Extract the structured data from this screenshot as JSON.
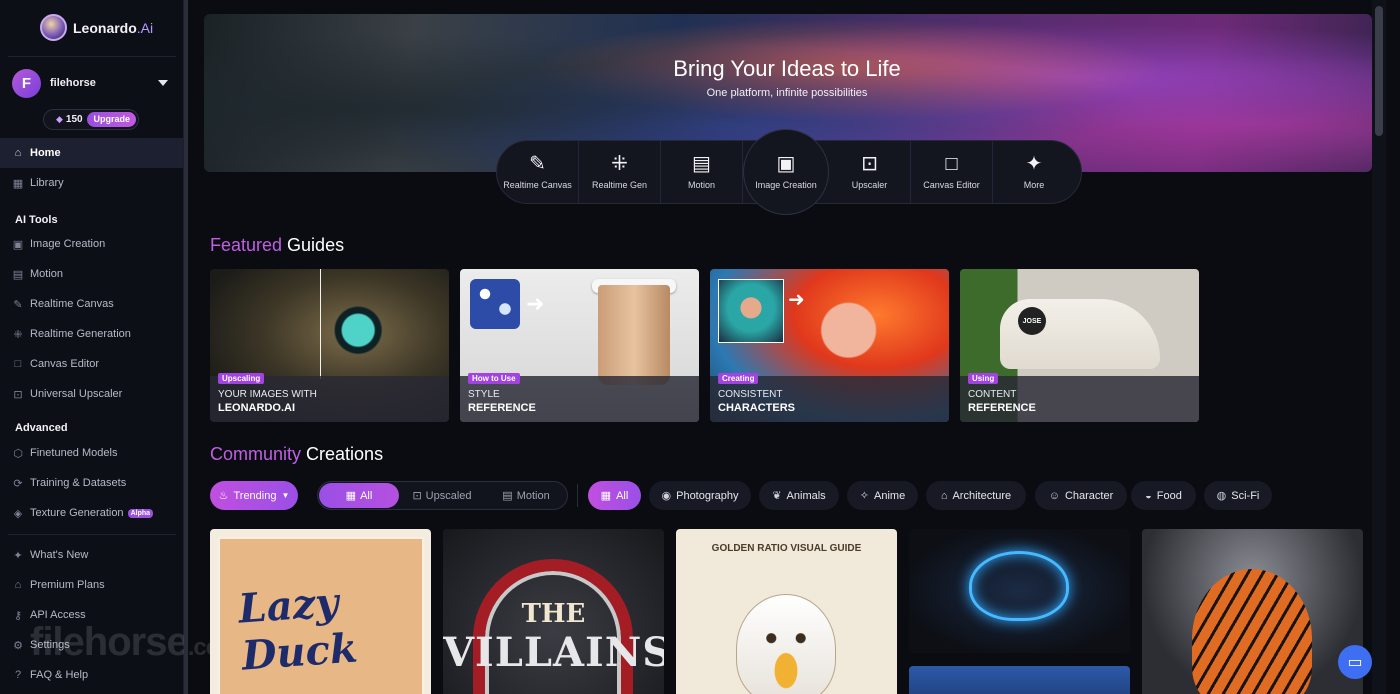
{
  "brand": {
    "name": "Leonardo",
    "suffix": ".Ai"
  },
  "user": {
    "initial": "F",
    "name": "filehorse",
    "tokens": "150",
    "upgrade_label": "Upgrade"
  },
  "nav": {
    "home": "Home",
    "library": "Library",
    "ai_tools_title": "AI Tools",
    "ai_tools": [
      "Image Creation",
      "Motion",
      "Realtime Canvas",
      "Realtime Generation",
      "Canvas Editor",
      "Universal Upscaler"
    ],
    "advanced_title": "Advanced",
    "advanced": [
      "Finetuned Models",
      "Training & Datasets",
      "Texture Generation"
    ],
    "alpha_badge": "Alpha",
    "footer": [
      "What's New",
      "Premium Plans",
      "API Access",
      "Settings",
      "FAQ & Help"
    ]
  },
  "hero": {
    "title": "Bring Your Ideas to Life",
    "subtitle": "One platform, infinite possibilities",
    "tools": [
      "Realtime Canvas",
      "Realtime Gen",
      "Motion",
      "Image Creation",
      "Upscaler",
      "Canvas Editor",
      "More"
    ]
  },
  "featured": {
    "title_accent": "Featured",
    "title_rest": " Guides",
    "guides": [
      {
        "tag": "Upscaling",
        "line1": "YOUR IMAGES WITH",
        "line2": "LEONARDO.AI"
      },
      {
        "tag": "How to Use",
        "line1": "STYLE",
        "line2": "REFERENCE"
      },
      {
        "tag": "Creating",
        "line1": "CONSISTENT",
        "line2": "CHARACTERS"
      },
      {
        "tag": "Using",
        "line1": "CONTENT",
        "line2": "REFERENCE"
      }
    ]
  },
  "community": {
    "title_accent": "Community",
    "title_rest": " Creations",
    "sort_label": "Trending",
    "segments": [
      "All",
      "Upscaled",
      "Motion"
    ],
    "categories": [
      "All",
      "Photography",
      "Animals",
      "Anime",
      "Architecture",
      "Character",
      "Food",
      "Sci-Fi"
    ]
  },
  "cards": {
    "card1_text": "Lazy Duck",
    "card2_line1": "THE",
    "card2_line2": "VILLAINS",
    "card3_text": "GOLDEN RATIO VISUAL GUIDE",
    "shoe_patch": "JOSE"
  },
  "watermark": {
    "main": "filehorse",
    "suffix": ".com"
  }
}
